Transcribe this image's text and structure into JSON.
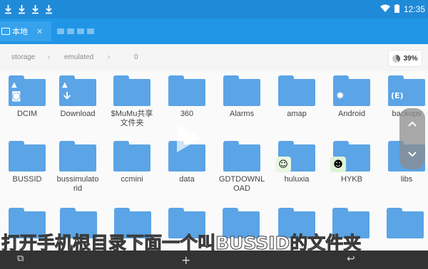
{
  "status_bar": {
    "download_icons": [
      "download-icon",
      "download-icon",
      "download-icon",
      "download-icon"
    ],
    "time": "12:35"
  },
  "tabs": [
    {
      "label": "本地",
      "close": "✕"
    }
  ],
  "breadcrumb": {
    "items": [
      "storage",
      "emulated",
      "0"
    ]
  },
  "storage_usage": "39%",
  "files": [
    {
      "name": "DCIM",
      "icon": "camera-icon"
    },
    {
      "name": "Download",
      "icon": "download-icon"
    },
    {
      "name": "$MuMu共享\n文件夹",
      "icon": "folder-icon"
    },
    {
      "name": "360",
      "icon": "folder-icon"
    },
    {
      "name": "Alarms",
      "icon": "folder-icon"
    },
    {
      "name": "amap",
      "icon": "folder-icon"
    },
    {
      "name": "Android",
      "icon": "gear-icon"
    },
    {
      "name": "backups",
      "icon": "es-icon"
    },
    {
      "name": "BUSSID",
      "icon": "folder-icon"
    },
    {
      "name": "bussimulato\nrid",
      "icon": "folder-icon"
    },
    {
      "name": "ccmini",
      "icon": "folder-icon"
    },
    {
      "name": "data",
      "icon": "folder-icon"
    },
    {
      "name": "GDTDOWNL\nOAD",
      "icon": "folder-icon"
    },
    {
      "name": "huluxia",
      "icon": "huluxia-app-icon"
    },
    {
      "name": "HYKB",
      "icon": "hykb-app-icon"
    },
    {
      "name": "libs",
      "icon": "folder-icon"
    }
  ],
  "caption": "打开手机根目录下面一个叫BUSSID的文件夹",
  "colors": {
    "status_bar": "#1f8ad8",
    "tab_bar": "#2196e6",
    "folder": "#5ba4e6"
  }
}
